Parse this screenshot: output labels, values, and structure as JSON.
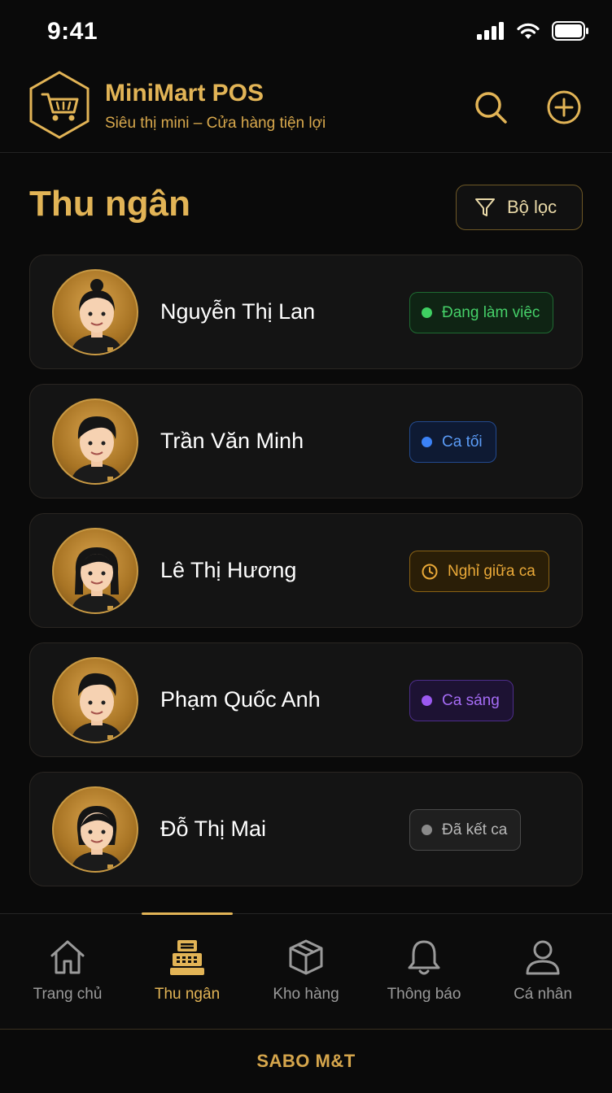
{
  "status": {
    "time": "9:41"
  },
  "header": {
    "title": "MiniMart POS",
    "subtitle": "Siêu thị mini – Cửa hàng tiện lợi"
  },
  "page": {
    "title": "Thu ngân",
    "filter_label": "Bộ lọc"
  },
  "cashiers": [
    {
      "name": "Nguyễn Thị Lan",
      "status": "Đang làm việc",
      "status_kind": "working",
      "color": "#2bbf4f"
    },
    {
      "name": "Trần Văn Minh",
      "status": "Ca tối",
      "status_kind": "evening",
      "color": "#3b82f6"
    },
    {
      "name": "Lê Thị Hương",
      "status": "Nghỉ giữa ca",
      "status_kind": "break",
      "color": "#e3a32c"
    },
    {
      "name": "Phạm Quốc Anh",
      "status": "Ca sáng",
      "status_kind": "morning",
      "color": "#9b59f0"
    },
    {
      "name": "Đỗ Thị Mai",
      "status": "Đã kết ca",
      "status_kind": "ended",
      "color": "#8a8a8a"
    }
  ],
  "nav": [
    {
      "label": "Trang chủ",
      "icon": "home-icon"
    },
    {
      "label": "Thu ngân",
      "icon": "cash-register-icon",
      "active": true
    },
    {
      "label": "Kho hàng",
      "icon": "box-icon"
    },
    {
      "label": "Thông báo",
      "icon": "bell-icon"
    },
    {
      "label": "Cá nhân",
      "icon": "user-icon"
    }
  ],
  "footer": {
    "text": "SABO M&T"
  },
  "colors": {
    "accent": "#e2b456",
    "background": "#0a0a0a",
    "card": "#141414"
  }
}
